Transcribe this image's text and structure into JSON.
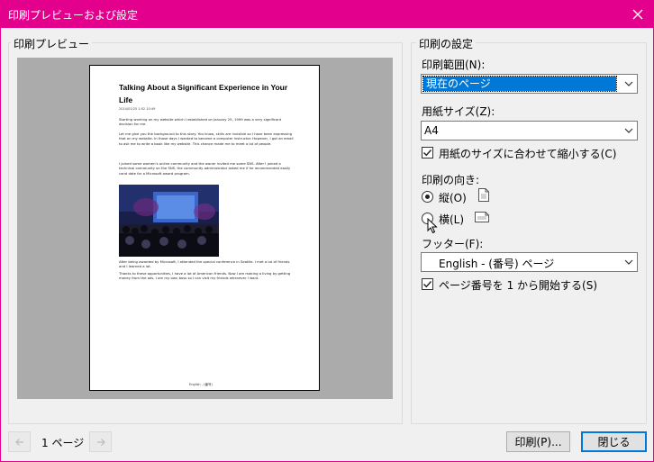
{
  "window": {
    "title": "印刷プレビューおよび設定"
  },
  "preview": {
    "group_title": "印刷プレビュー",
    "page": {
      "title": "Talking About a Significant Experience in Your Life",
      "meta": "2014/01/25 1:02          10:49",
      "paragraphs": [
        "Starting working on my website which I established on January 25, 1999 was a very significant decision for me.",
        "Let me give you the background to this story. You know, skills are invisible so I have been expressing that on my website. In those days I wanted to become a computer instructor. However, I got an email to ask me to write a book like my website. This chance made me to meet a lot of people.",
        "I joined some women's online community and the owner invited me some SNS. After I joined a technical community on the SNS, the community administrator asked me if he recommended easily cand date for a Microsoft award program.",
        "After being awarded by Microsoft, I attended the special conference in Seattle. I met a lot of friends and I learned a lot.",
        "Thanks to these opportunities, I have a lot of American friends. Now I am making a living by getting money from the ads. I am my own boss so I can visit my friends whenever I want."
      ],
      "footer": "English - (番号)"
    },
    "page_label": "1 ページ"
  },
  "settings": {
    "group_title": "印刷の設定",
    "range_label": "印刷範囲(N):",
    "range_value": "現在のページ",
    "paper_label": "用紙サイズ(Z):",
    "paper_value": "A4",
    "shrink_label": "用紙のサイズに合わせて縮小する(C)",
    "orientation_label": "印刷の向き:",
    "portrait_label": "縦(O)",
    "landscape_label": "横(L)",
    "footer_label": "フッター(F):",
    "footer_value": "English - (番号) ページ",
    "start_one_label": "ページ番号を 1 から開始する(S)"
  },
  "buttons": {
    "print": "印刷(P)...",
    "close": "閉じる"
  },
  "colors": {
    "accent": "#e3008c",
    "selection": "#0078d7"
  }
}
